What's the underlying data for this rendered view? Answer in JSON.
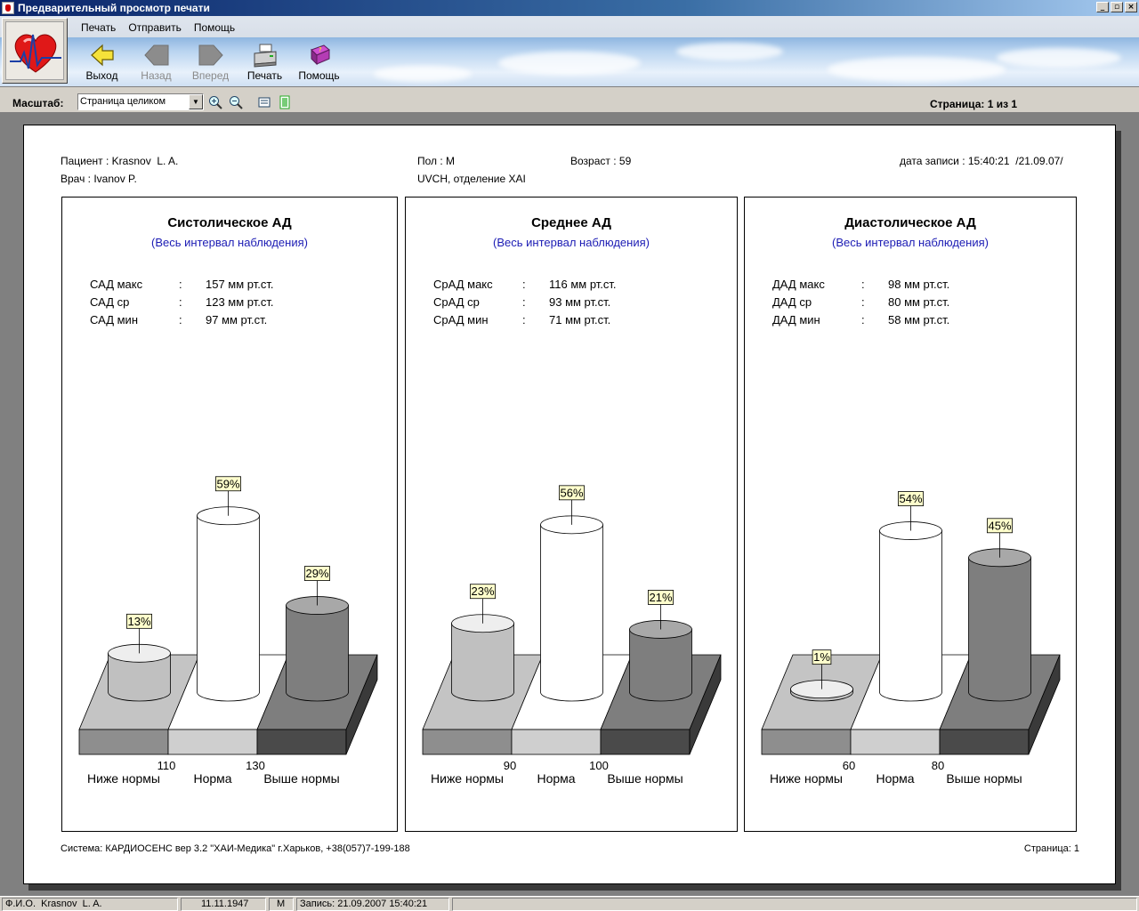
{
  "window": {
    "title": "Предварительный просмотр печати",
    "buttons": [
      "_",
      "▫",
      "×"
    ]
  },
  "menu": [
    "Печать",
    "Отправить",
    "Помощь"
  ],
  "toolbar": [
    {
      "label": "Выход",
      "icon": "exit-arrow-icon",
      "enabled": true
    },
    {
      "label": "Назад",
      "icon": "back-arrow-icon",
      "enabled": false
    },
    {
      "label": "Вперед",
      "icon": "forward-arrow-icon",
      "enabled": false
    },
    {
      "label": "Печать",
      "icon": "printer-icon",
      "enabled": true
    },
    {
      "label": "Помощь",
      "icon": "help-book-icon",
      "enabled": true
    }
  ],
  "zoom": {
    "label": "Масштаб:",
    "value": "Страница целиком",
    "page_indicator": "Страница: 1 из 1"
  },
  "report": {
    "patient": "Пациент : Krasnov  L. A.",
    "doctor": "Врач : Ivanov P.",
    "sex": "Пол : M",
    "department": "UVCH, отделение XAI",
    "age": "Возраст : 59",
    "record_date": "дата записи : 15:40:21  /21.09.07/",
    "footer_left": "Система: КАРДИОСЕНС вер 3.2 \"ХАИ-Медика\" г.Харьков, +38(057)7-199-188",
    "footer_right": "Страница: 1"
  },
  "panels": [
    {
      "title": "Систолическое АД",
      "subtitle": "(Весь интервал наблюдения)",
      "stats": [
        {
          "name": "САД макс",
          "sep": ":",
          "value": "157 мм рт.ст."
        },
        {
          "name": "САД ср",
          "sep": ":",
          "value": "123 мм рт.ст."
        },
        {
          "name": "САД мин",
          "sep": ":",
          "value": "97 мм рт.ст."
        }
      ],
      "chart_data": {
        "type": "bar",
        "categories": [
          "Ниже нормы",
          "Норма",
          "Выше нормы"
        ],
        "values": [
          13,
          59,
          29
        ],
        "value_labels": [
          "13%",
          "59%",
          "29%"
        ],
        "thresholds": [
          "110",
          "130"
        ]
      }
    },
    {
      "title": "Среднее АД",
      "subtitle": "(Весь интервал наблюдения)",
      "stats": [
        {
          "name": "СрАД макс",
          "sep": ":",
          "value": "116 мм рт.ст."
        },
        {
          "name": "СрАД ср",
          "sep": ":",
          "value": "93 мм рт.ст."
        },
        {
          "name": "СрАД мин",
          "sep": ":",
          "value": "71 мм рт.ст."
        }
      ],
      "chart_data": {
        "type": "bar",
        "categories": [
          "Ниже нормы",
          "Норма",
          "Выше нормы"
        ],
        "values": [
          23,
          56,
          21
        ],
        "value_labels": [
          "23%",
          "56%",
          "21%"
        ],
        "thresholds": [
          "90",
          "100"
        ]
      }
    },
    {
      "title": "Диастолическое АД",
      "subtitle": "(Весь интервал наблюдения)",
      "stats": [
        {
          "name": "ДАД макс",
          "sep": ":",
          "value": "98 мм рт.ст."
        },
        {
          "name": "ДАД ср",
          "sep": ":",
          "value": "80 мм рт.ст."
        },
        {
          "name": "ДАД мин",
          "sep": ":",
          "value": "58 мм рт.ст."
        }
      ],
      "chart_data": {
        "type": "bar",
        "categories": [
          "Ниже нормы",
          "Норма",
          "Выше нормы"
        ],
        "values": [
          1,
          54,
          45
        ],
        "value_labels": [
          "1%",
          "54%",
          "45%"
        ],
        "thresholds": [
          "60",
          "80"
        ]
      }
    }
  ],
  "statusbar": {
    "fio": "Ф.И.О.  Krasnov  L. A.",
    "dob": "11.11.1947",
    "sex": "M",
    "record": "Запись: 21.09.2007 15:40:21"
  },
  "colors": {
    "below": "#c4c4c4",
    "normal": "#ffffff",
    "above": "#7e7e7e",
    "subtitle": "#1c1cb4",
    "label_bg": "#ffffcc"
  }
}
